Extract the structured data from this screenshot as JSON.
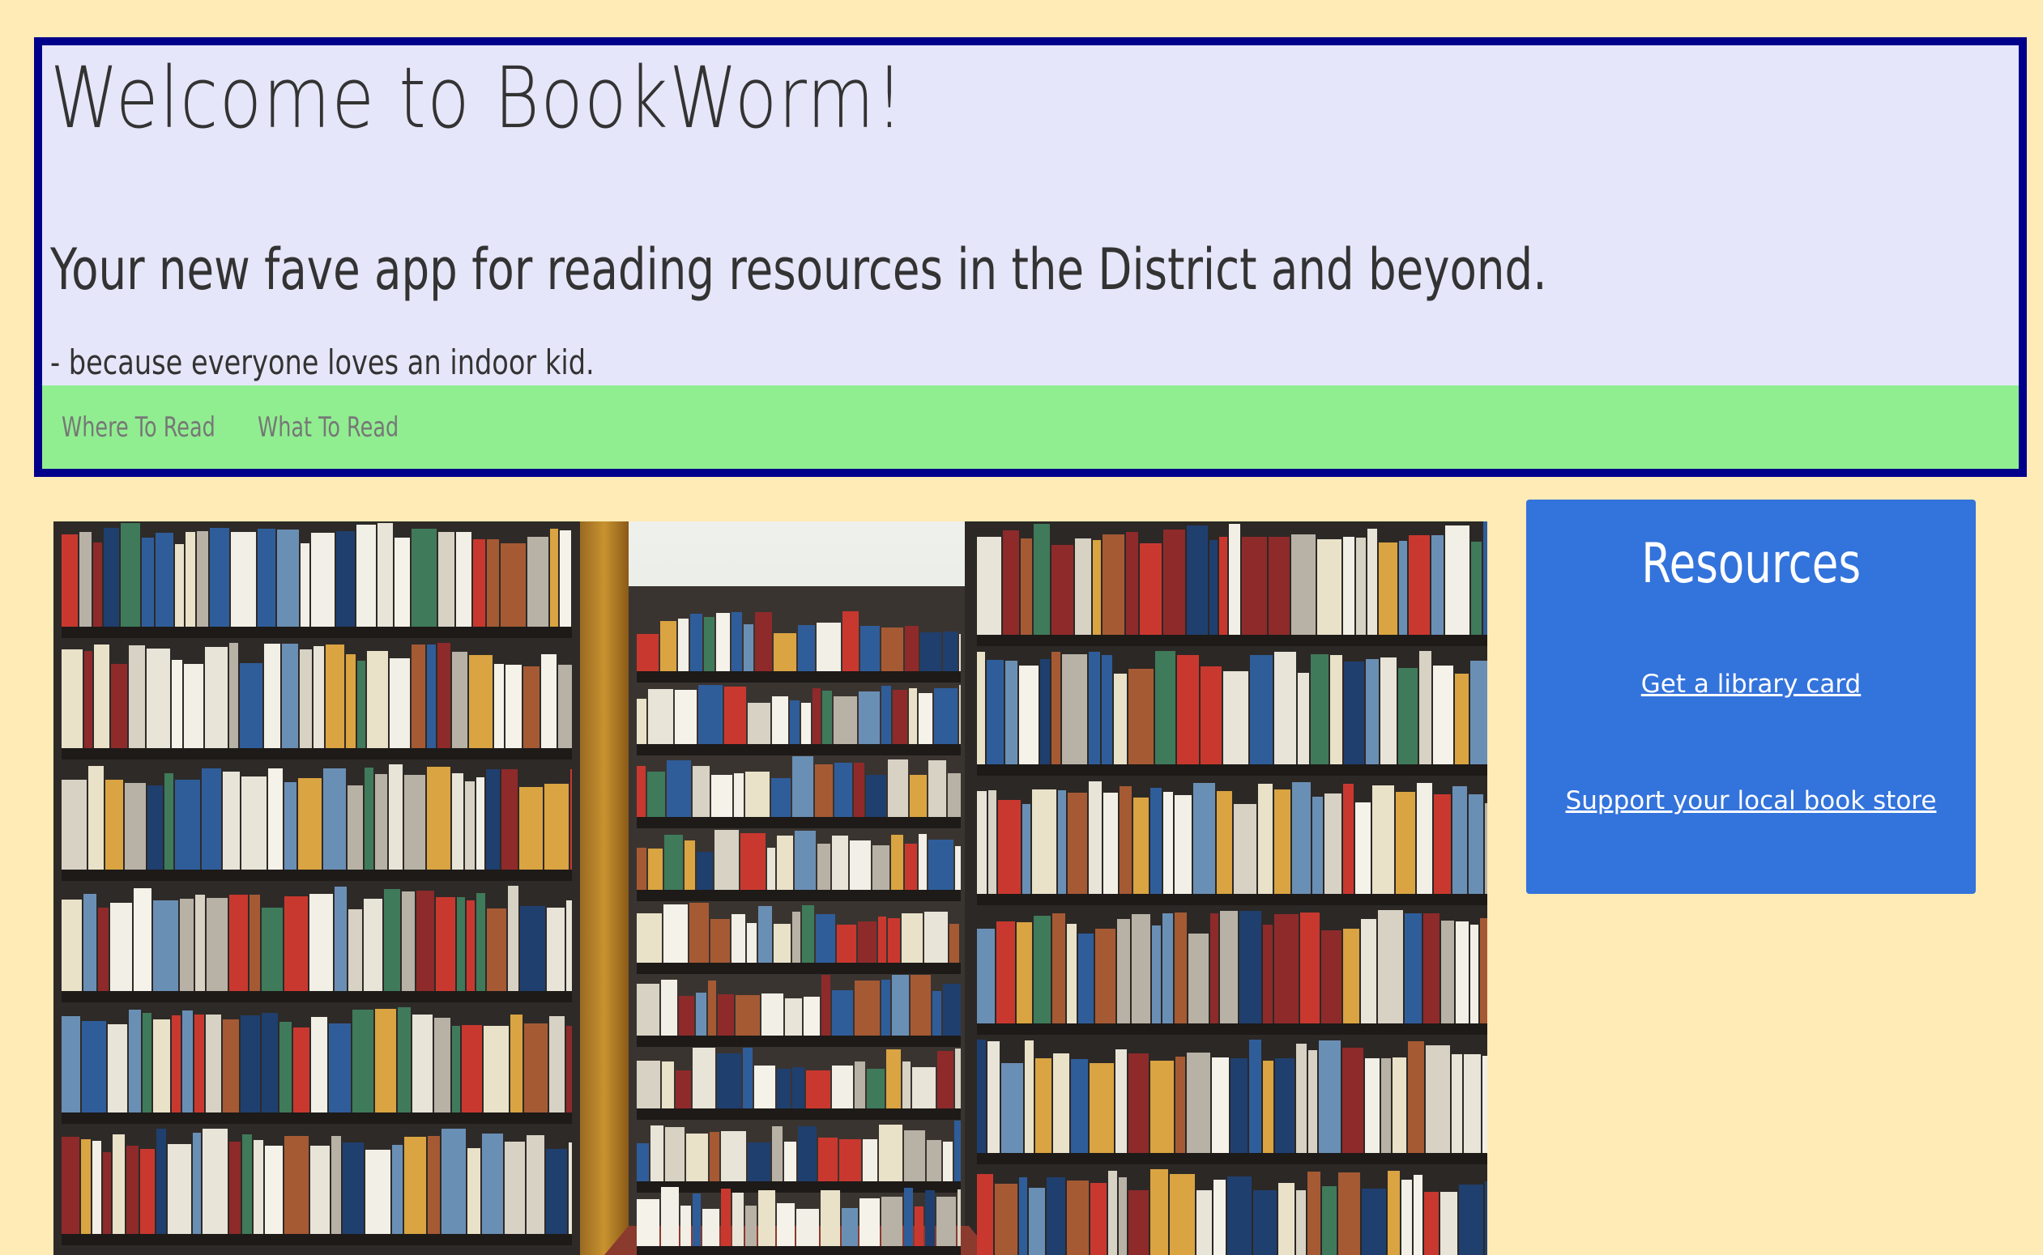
{
  "header": {
    "title": "Welcome to BookWorm!",
    "tagline": "Your new fave app for reading resources in the District and beyond.",
    "subtagline": "- because everyone loves an indoor kid."
  },
  "nav": {
    "items": [
      {
        "label": "Where To Read"
      },
      {
        "label": "What To Read"
      }
    ]
  },
  "hero_image": {
    "icon": "library-bookshelves-photo"
  },
  "resources": {
    "title": "Resources",
    "links": [
      {
        "label": "Get a library card"
      },
      {
        "label": "Support your local book store"
      }
    ]
  },
  "colors": {
    "page_background": "#FFEBB5",
    "header_background": "#E6E6FA",
    "header_border": "#00008B",
    "nav_background": "#90EE90",
    "nav_text": "#777777",
    "resources_background": "#3373DC",
    "text_dark": "#333333"
  }
}
